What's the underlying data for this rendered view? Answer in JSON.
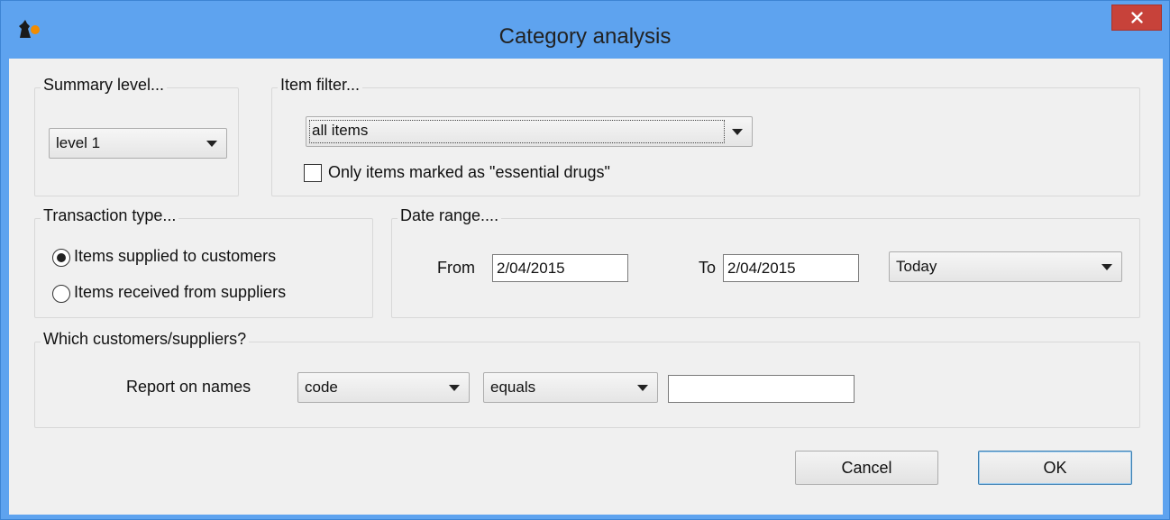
{
  "window": {
    "title": "Category analysis",
    "close_label": "×"
  },
  "summary_level": {
    "label": "Summary level...",
    "selected": "level 1"
  },
  "item_filter": {
    "label": "Item filter...",
    "selected": "all items",
    "essential_checkbox_label": "Only items marked as \"essential drugs\"",
    "essential_checked": false
  },
  "transaction_type": {
    "label": "Transaction type...",
    "options": [
      "Items supplied to customers",
      "Items received from suppliers"
    ],
    "selected_index": 0
  },
  "date_range": {
    "label": "Date range....",
    "from_label": "From",
    "from_value": "2/04/2015",
    "to_label": "To",
    "to_value": "2/04/2015",
    "preset": "Today"
  },
  "names_filter": {
    "label": "Which customers/suppliers?",
    "report_label": "Report on names",
    "field": "code",
    "operator": "equals",
    "value": ""
  },
  "buttons": {
    "cancel": "Cancel",
    "ok": "OK"
  },
  "colors": {
    "titlebar": "#5ea3ef",
    "close_button": "#c7423a",
    "dialog_bg": "#f0f0f0"
  }
}
